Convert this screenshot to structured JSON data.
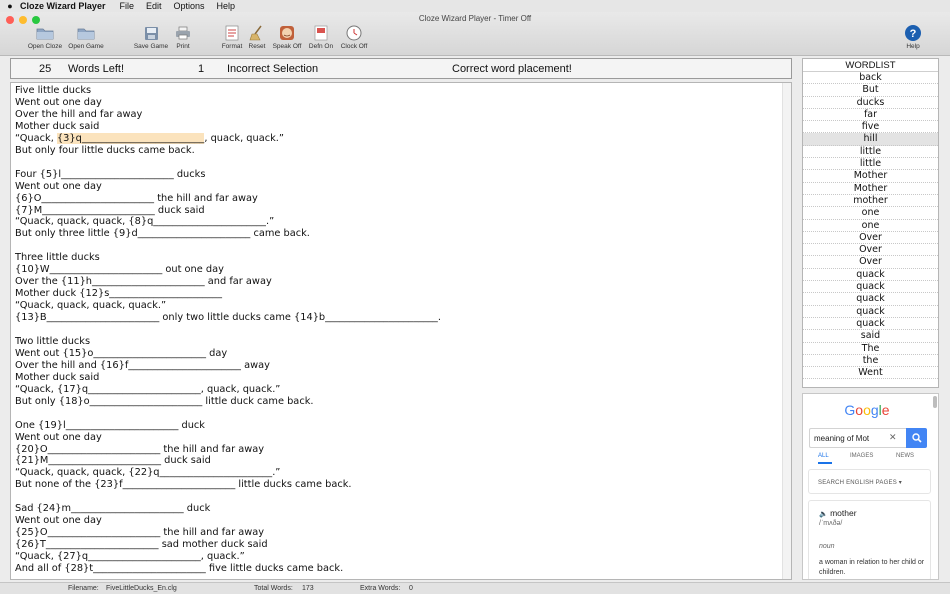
{
  "menubar": {
    "app_name": "Cloze Wizard Player",
    "items": [
      "File",
      "Edit",
      "Options",
      "Help"
    ]
  },
  "window": {
    "title": "Cloze Wizard Player - Timer Off"
  },
  "toolbar": [
    {
      "label": "Open Cloze",
      "icon": "folder-icon"
    },
    {
      "label": "Open Game",
      "icon": "folder-icon"
    },
    {
      "label": "Save Game",
      "icon": "save-icon"
    },
    {
      "label": "Print",
      "icon": "printer-icon"
    },
    {
      "label": "Format",
      "icon": "format-icon"
    },
    {
      "label": "Reset",
      "icon": "broom-icon"
    },
    {
      "label": "Speak Off",
      "icon": "speaker-face-icon"
    },
    {
      "label": "Defn On",
      "icon": "dictionary-icon"
    },
    {
      "label": "Clock Off",
      "icon": "clock-icon"
    },
    {
      "label": "Help",
      "icon": "help-icon"
    }
  ],
  "status": {
    "words_left_count": "25",
    "words_left_label": "Words Left!",
    "incorrect_count": "1",
    "incorrect_label": "Incorrect Selection",
    "message": "Correct word placement!"
  },
  "text_lines": [
    "Five little ducks",
    "Went out one day",
    "Over the hill and far away",
    "Mother duck said",
    "“Quack, {3}q_________________________, quack, quack.”",
    "But only four little ducks came back.",
    "",
    "Four {5}l_______________________ ducks",
    "Went out one day",
    "{6}O_______________________ the hill and far away",
    "{7}M_______________________ duck said",
    "“Quack, quack, quack, {8}q_______________________.”",
    "But only three little {9}d_______________________ came back.",
    "",
    "Three little ducks",
    "{10}W_______________________ out one day",
    "Over the {11}h_______________________ and far away",
    "Mother duck {12}s_______________________",
    "“Quack, quack, quack, quack.”",
    "{13}B_______________________ only two little ducks came {14}b_______________________.",
    "",
    "Two little ducks",
    "Went out {15}o_______________________ day",
    "Over the hill and {16}f_______________________ away",
    "Mother duck said",
    "“Quack, {17}q_______________________, quack, quack.”",
    "But only {18}o_______________________ little duck came back.",
    "",
    "One {19}l_______________________ duck",
    "Went out one day",
    "{20}O_______________________ the hill and far away",
    "{21}M_______________________ duck said",
    "“Quack, quack, quack, {22}q_______________________.”",
    "But none of the {23}f_______________________ little ducks came back.",
    "",
    "Sad {24}m_______________________ duck",
    "Went out one day",
    "{25}O_______________________ the hill and far away",
    "{26}T_______________________ sad mother duck said",
    "“Quack, {27}q_______________________, quack.”",
    "And all of {28}t_______________________ five little ducks came back."
  ],
  "highlight": {
    "before": "“Quack, ",
    "marked": "{3}q_________________________",
    "after": ", quack, quack.”"
  },
  "wordlist": {
    "title": "WORDLIST",
    "selected_index": 5,
    "items": [
      "back",
      "But",
      "ducks",
      "far",
      "five",
      "hill",
      "little",
      "little",
      "Mother",
      "Mother",
      "mother",
      "one",
      "one",
      "Over",
      "Over",
      "Over",
      "quack",
      "quack",
      "quack",
      "quack",
      "quack",
      "said",
      "The",
      "the",
      "Went"
    ]
  },
  "web_panel": {
    "logo": [
      "G",
      "o",
      "o",
      "g",
      "l",
      "e"
    ],
    "logo_colors": [
      "#4285f4",
      "#ea4335",
      "#fbbc05",
      "#4285f4",
      "#34a853",
      "#ea4335"
    ],
    "search_value": "meaning of Mot",
    "tabs": [
      "ALL",
      "IMAGES",
      "NEWS"
    ],
    "search_pages_label": "SEARCH ENGLISH PAGES ▾",
    "word": "mother",
    "phonetic": "/ˈmʌðə/",
    "part_of_speech": "noun",
    "definition": "a woman in relation to her child or children."
  },
  "footer": {
    "filename_label": "Filename:",
    "filename": "FiveLittleDucks_En.clg",
    "total_words_label": "Total Words:",
    "total_words": "173",
    "extra_words_label": "Extra Words:",
    "extra_words": "0"
  }
}
